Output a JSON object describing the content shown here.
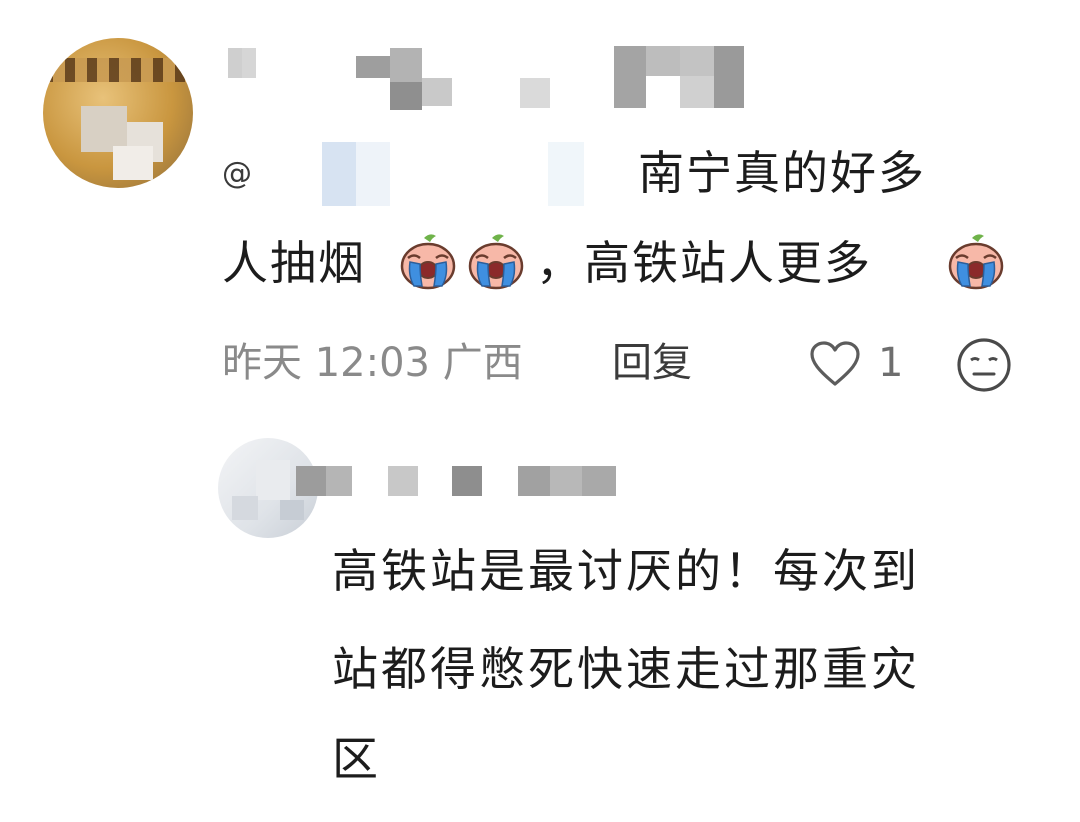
{
  "comment": {
    "mention_prefix": "@",
    "text_line1": "南宁真的好多",
    "text_line2_a": "人抽烟",
    "text_line2_b": "，高铁站人更多",
    "emoji_name": "crying-face-emoji",
    "timestamp": "昨天 12:03 广西",
    "reply_label": "回复",
    "like_count": "1"
  },
  "reply": {
    "text_line1": "高铁站是最讨厌的！每次到",
    "text_line2": "站都得憋死快速走过那重灾",
    "text_line3": "区"
  },
  "colors": {
    "text": "#1c1c1c",
    "meta": "#8a8a8a",
    "mosaic": "#a9a9a9",
    "emoji_skin": "#f7b8a8",
    "emoji_tear": "#3f8fe0"
  }
}
